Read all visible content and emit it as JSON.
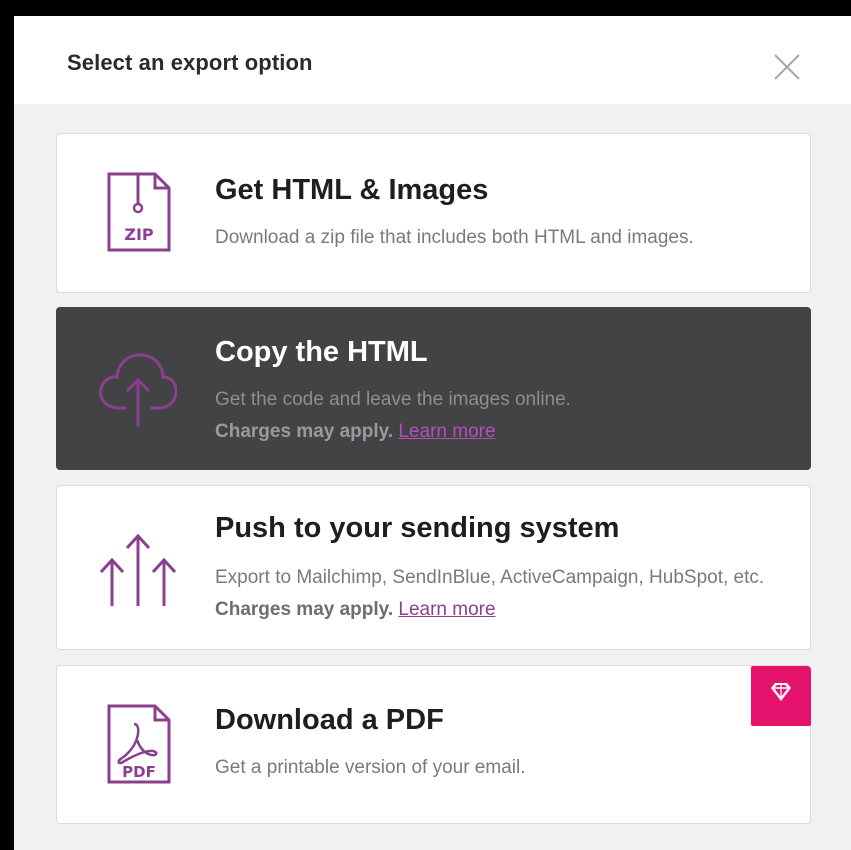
{
  "modal": {
    "title": "Select an export option"
  },
  "options": [
    {
      "title": "Get HTML & Images",
      "description": "Download a zip file that includes both HTML and images.",
      "icon": "zip-file-icon",
      "file_label": "ZIP"
    },
    {
      "title": "Copy the HTML",
      "description": "Get the code and leave the images online.",
      "charges": "Charges may apply.",
      "link": "Learn more",
      "icon": "cloud-upload-icon",
      "state": "hovered"
    },
    {
      "title": "Push to your sending system",
      "description": "Export to Mailchimp, SendInBlue, ActiveCampaign, HubSpot, etc.",
      "charges": "Charges may apply.",
      "link": "Learn more",
      "icon": "push-arrows-icon"
    },
    {
      "title": "Download a PDF",
      "description": "Get a printable version of your email.",
      "icon": "pdf-file-icon",
      "file_label": "PDF",
      "badge": "premium-diamond-icon"
    }
  ],
  "colors": {
    "accent": "#8b3f8f",
    "hover_bg": "#434346",
    "badge": "#e5126e",
    "background": "#f1f1f1"
  }
}
